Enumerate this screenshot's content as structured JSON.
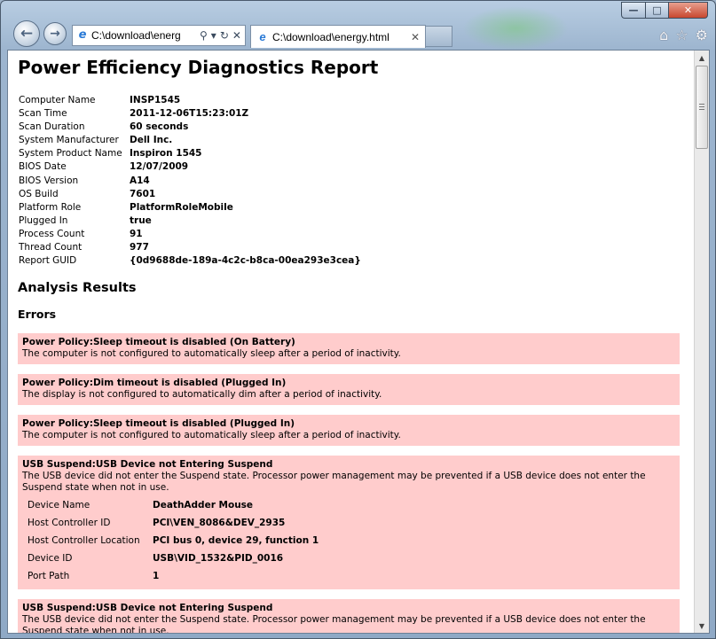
{
  "browser": {
    "address_value": "C:\\download\\energ",
    "tab_title": "C:\\download\\energy.html"
  },
  "report": {
    "title": "Power Efficiency Diagnostics Report",
    "info": [
      {
        "key": "Computer Name",
        "value": "INSP1545"
      },
      {
        "key": "Scan Time",
        "value": "2011-12-06T15:23:01Z"
      },
      {
        "key": "Scan Duration",
        "value": "60 seconds"
      },
      {
        "key": "System Manufacturer",
        "value": "Dell Inc."
      },
      {
        "key": "System Product Name",
        "value": "Inspiron 1545"
      },
      {
        "key": "BIOS Date",
        "value": "12/07/2009"
      },
      {
        "key": "BIOS Version",
        "value": "A14"
      },
      {
        "key": "OS Build",
        "value": "7601"
      },
      {
        "key": "Platform Role",
        "value": "PlatformRoleMobile"
      },
      {
        "key": "Plugged In",
        "value": "true"
      },
      {
        "key": "Process Count",
        "value": "91"
      },
      {
        "key": "Thread Count",
        "value": "977"
      },
      {
        "key": "Report GUID",
        "value": "{0d9688de-189a-4c2c-b8ca-00ea293e3cea}"
      }
    ],
    "analysis_heading": "Analysis Results",
    "errors_heading": "Errors",
    "errors": [
      {
        "title": "Power Policy:Sleep timeout is disabled (On Battery)",
        "desc": "The computer is not configured to automatically sleep after a period of inactivity."
      },
      {
        "title": "Power Policy:Dim timeout is disabled (Plugged In)",
        "desc": "The display is not configured to automatically dim after a period of inactivity."
      },
      {
        "title": "Power Policy:Sleep timeout is disabled (Plugged In)",
        "desc": "The computer is not configured to automatically sleep after a period of inactivity."
      },
      {
        "title": "USB Suspend:USB Device not Entering Suspend",
        "desc": "The USB device did not enter the Suspend state. Processor power management may be prevented if a USB device does not enter the Suspend state when not in use.",
        "details": [
          {
            "key": "Device Name",
            "value": "DeathAdder Mouse"
          },
          {
            "key": "Host Controller ID",
            "value": "PCI\\VEN_8086&DEV_2935"
          },
          {
            "key": "Host Controller Location",
            "value": "PCI bus 0, device 29, function 1"
          },
          {
            "key": "Device ID",
            "value": "USB\\VID_1532&PID_0016"
          },
          {
            "key": "Port Path",
            "value": "1"
          }
        ]
      },
      {
        "title": "USB Suspend:USB Device not Entering Suspend",
        "desc": "The USB device did not enter the Suspend state. Processor power management may be prevented if a USB device does not enter the Suspend state when not in use."
      }
    ]
  }
}
